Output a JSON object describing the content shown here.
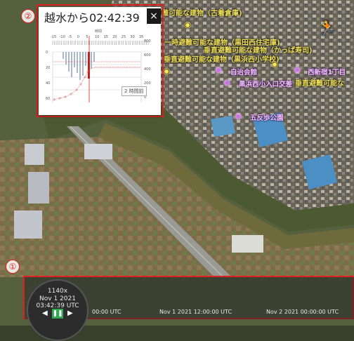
{
  "map_labels": {
    "top": "難可能な建物（古着倉庫)",
    "bldg1": "一時避難可能な建物（黒田西住宅庫)",
    "kappa": "垂直避難可能な建物（かっぱ寿司)",
    "school": "垂直避難可能な建物（黒浜西小学校)",
    "jichikai": "自治会館",
    "nishishin": "西新宿1丁目",
    "junction": "黒浜西小入口交差",
    "vertical_right": "垂直避難可能な",
    "goboshi": "五反歩公園"
  },
  "markers": {
    "one": "①",
    "two": "②"
  },
  "popup": {
    "title": "越水から02:42:39",
    "close": "×",
    "button": "2 時間前"
  },
  "chart_data": {
    "type": "bar",
    "x_label": "時間",
    "x_ticks": [
      "-15",
      "-10",
      "-5",
      "0",
      "5",
      "10",
      "15",
      "20",
      "25",
      "30",
      "35"
    ],
    "y_left_ticks": [
      "0",
      "20",
      "40",
      "60"
    ],
    "y_right_ticks": [
      "800",
      "600",
      "400",
      "200",
      "0"
    ]
  },
  "timeline": {
    "speed": "1140x",
    "date": "Nov 1 2021",
    "time": "03:42:39 UTC",
    "tick_labels": [
      "00:00 UTC",
      "Nov 1 2021 12:00:00 UTC",
      "Nov 2 2021 00:00:00 UTC"
    ]
  },
  "colors": {
    "highlight": "#e02020",
    "label": "#f3e25a",
    "poi": "#d070e8",
    "runner": "#35d84a"
  },
  "icons": {
    "runner": "running-person-icon",
    "pin": "map-pin-icon"
  }
}
